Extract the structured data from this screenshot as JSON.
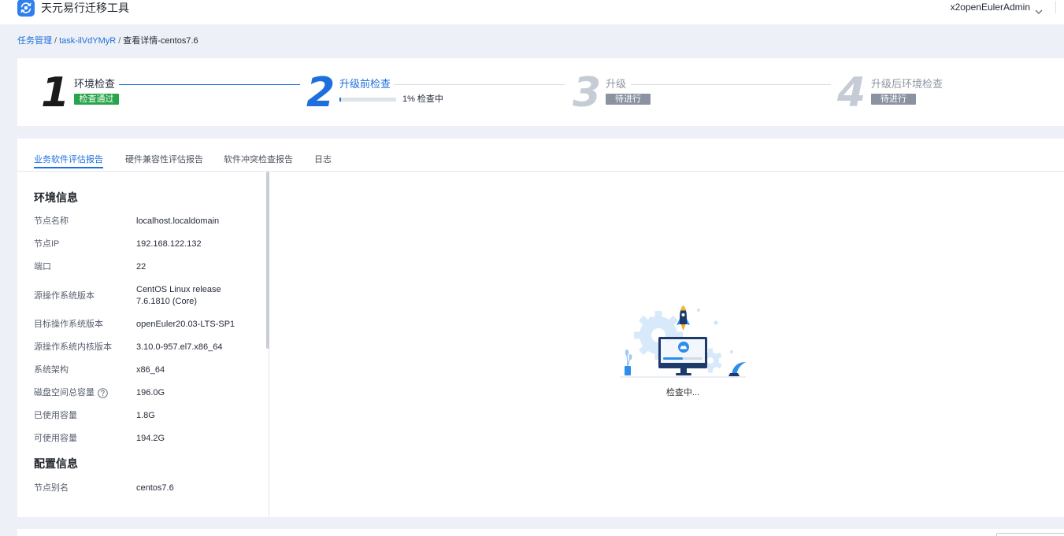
{
  "app": {
    "title": "天元易行迁移工具",
    "logo_icon": "migration-tool-logo-icon"
  },
  "header": {
    "user_name": "x2openEulerAdmin",
    "user_menu_icon": "chevron-down-icon"
  },
  "breadcrumb": {
    "separator": "/",
    "items": [
      {
        "label": "任务管理",
        "is_link": true
      },
      {
        "label": "task-ilVdYMyR",
        "is_link": true
      },
      {
        "label": "查看详情-centos7.6",
        "is_link": false
      }
    ]
  },
  "steps": [
    {
      "number": "1",
      "title": "环境检查",
      "status": "检查通过",
      "completed": true,
      "current": false
    },
    {
      "number": "2",
      "title": "升级前检查",
      "progress": 0.01,
      "progress_label": "1%",
      "status": "检查中",
      "completed": false,
      "current": true
    },
    {
      "number": "3",
      "title": "升级",
      "status": "待进行",
      "completed": false,
      "current": false
    },
    {
      "number": "4",
      "title": "升级后环境检查",
      "status": "待进行",
      "completed": false,
      "current": false
    }
  ],
  "tabs": [
    {
      "label": "业务软件评估报告",
      "selected": true
    },
    {
      "label": "硬件兼容性评估报告",
      "selected": false
    },
    {
      "label": "软件冲突检查报告",
      "selected": false
    },
    {
      "label": "日志",
      "selected": false
    }
  ],
  "env_info": {
    "title": "环境信息",
    "rows": [
      {
        "label": "节点名称",
        "value": "localhost.localdomain"
      },
      {
        "label": "节点IP",
        "value": "192.168.122.132"
      },
      {
        "label": "端口",
        "value": "22"
      },
      {
        "label": "源操作系统版本",
        "value": "CentOS Linux release 7.6.1810 (Core)"
      },
      {
        "label": "目标操作系统版本",
        "value": "openEuler20.03-LTS-SP1"
      },
      {
        "label": "源操作系统内核版本",
        "value": "3.10.0-957.el7.x86_64"
      },
      {
        "label": "系统架构",
        "value": "x86_64"
      },
      {
        "label": "磁盘空间总容量",
        "value": "196.0G",
        "help_icon": "help-circle-icon"
      },
      {
        "label": "已使用容量",
        "value": "1.8G"
      },
      {
        "label": "可使用容量",
        "value": "194.2G"
      }
    ]
  },
  "config_info": {
    "title": "配置信息",
    "rows": [
      {
        "label": "节点别名",
        "value": "centos7.6"
      }
    ]
  },
  "loading": {
    "text": "检查中...",
    "illustration_icon": "checking-computer-illustration-icon"
  },
  "colors": {
    "accent": "#1e6fde",
    "success": "#27a54a",
    "pending": "#8b93a2",
    "page_background": "#edf0f6"
  }
}
